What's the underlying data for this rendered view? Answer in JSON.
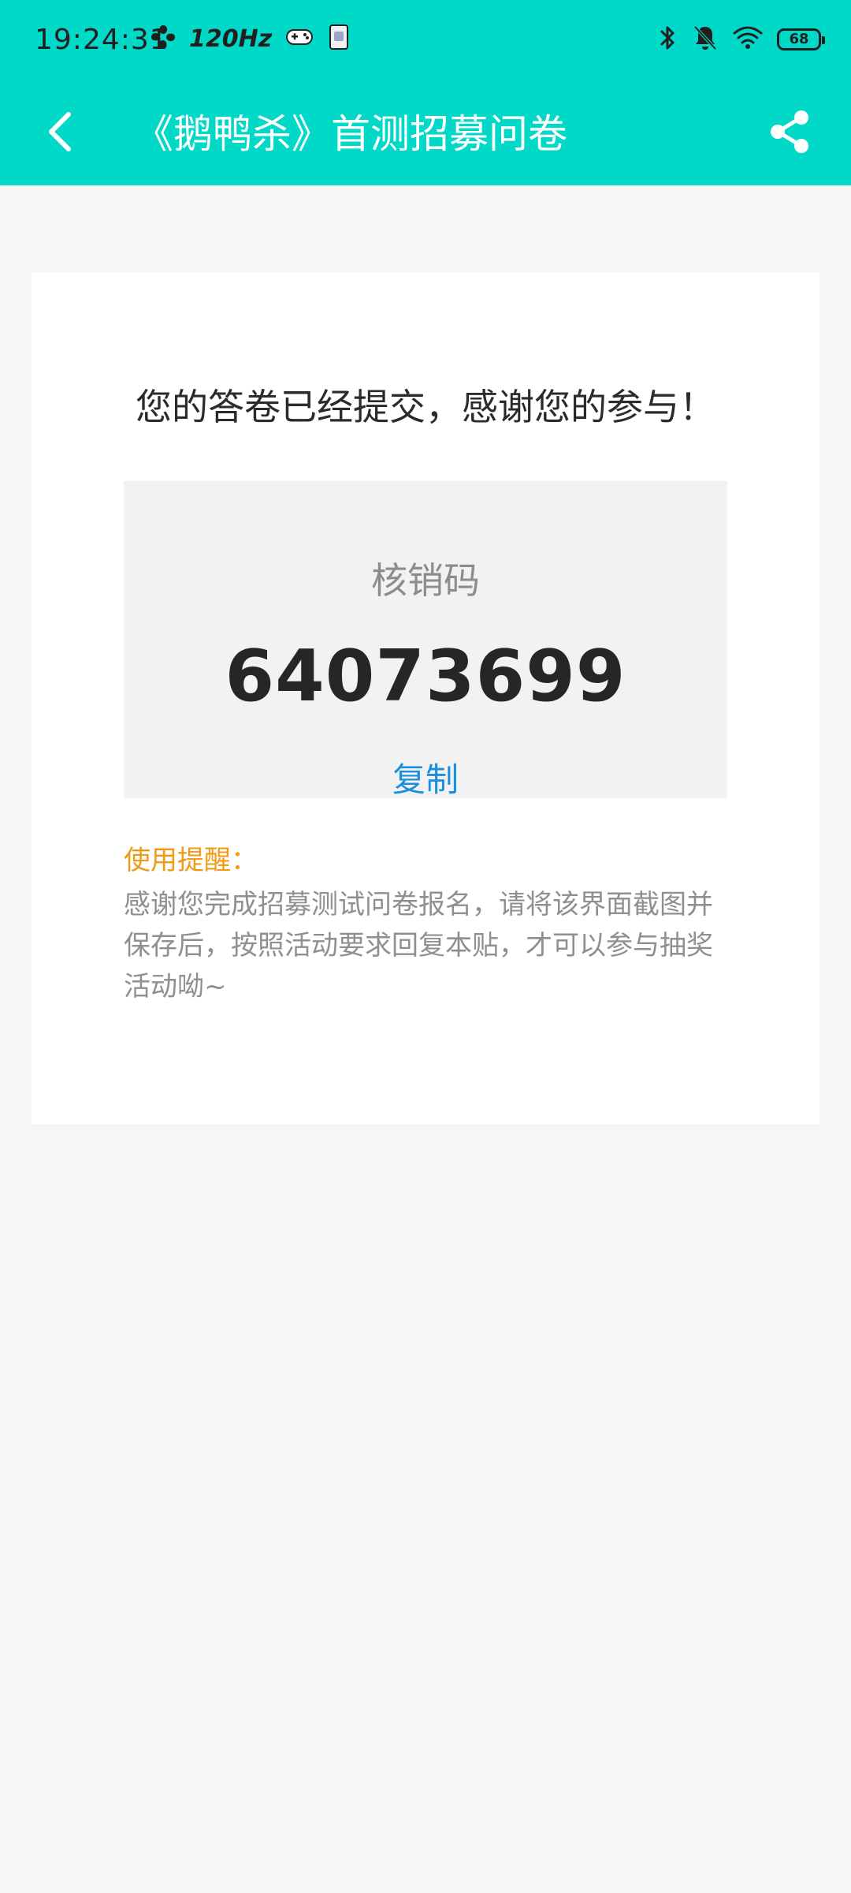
{
  "status_bar": {
    "time": "19:24:31",
    "refresh_rate": "120Hz",
    "battery": "68"
  },
  "app_bar": {
    "title": "《鹅鸭杀》首测招募问卷"
  },
  "card": {
    "success_message": "您的答卷已经提交，感谢您的参与！",
    "code_label": "核销码",
    "code_value": "64073699",
    "copy_label": "复制",
    "tip_title": "使用提醒：",
    "tip_body": "感谢您完成招募测试问卷报名，请将该界面截图并保存后，按照活动要求回复本贴，才可以参与抽奖活动呦~"
  },
  "colors": {
    "top_bar": "#00d8c8",
    "page_bg": "#f6f6f6",
    "card_bg": "#ffffff",
    "code_box_bg": "#f2f2f2",
    "copy_link": "#1a8fe0",
    "tip_title": "#f19a13"
  },
  "icons": {
    "back": "back-arrow-icon",
    "share": "share-icon",
    "status_left": [
      "fan-icon",
      "gamepad-icon",
      "sim-card-icon"
    ],
    "status_right": [
      "bluetooth-icon",
      "bell-off-icon",
      "wifi-icon",
      "battery-icon"
    ]
  }
}
